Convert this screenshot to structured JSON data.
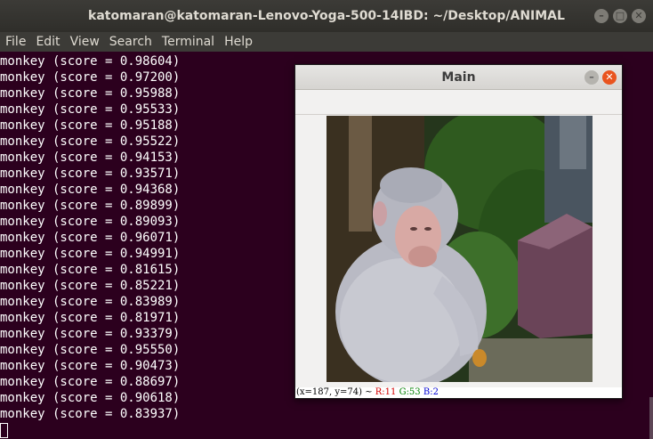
{
  "terminal": {
    "title": "katomaran@katomaran-Lenovo-Yoga-500-14IBD: ~/Desktop/ANIMAL",
    "menu": [
      "File",
      "Edit",
      "View",
      "Search",
      "Terminal",
      "Help"
    ],
    "lines": [
      "monkey (score = 0.98604)",
      "monkey (score = 0.97200)",
      "monkey (score = 0.95988)",
      "monkey (score = 0.95533)",
      "monkey (score = 0.95188)",
      "monkey (score = 0.95522)",
      "monkey (score = 0.94153)",
      "monkey (score = 0.93571)",
      "monkey (score = 0.94368)",
      "monkey (score = 0.89899)",
      "monkey (score = 0.89093)",
      "monkey (score = 0.96071)",
      "monkey (score = 0.94991)",
      "monkey (score = 0.81615)",
      "monkey (score = 0.85221)",
      "monkey (score = 0.83989)",
      "monkey (score = 0.81971)",
      "monkey (score = 0.93379)",
      "monkey (score = 0.95550)",
      "monkey (score = 0.90473)",
      "monkey (score = 0.88697)",
      "monkey (score = 0.90618)",
      "monkey (score = 0.83937)"
    ]
  },
  "main_window": {
    "title": "Main",
    "status": {
      "coords": "(x=187, y=74) ~",
      "r": "R:11",
      "g": "G:53",
      "b": "B:2"
    }
  },
  "colors": {
    "terminal_bg": "#2c001e",
    "close_button": "#e9541f"
  }
}
